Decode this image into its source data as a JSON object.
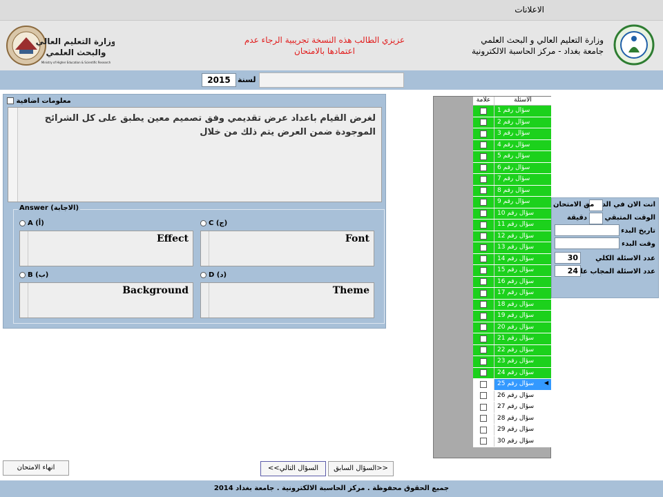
{
  "window": {
    "title": "الاعلانات"
  },
  "banner": {
    "notice_line1": "عزيزي الطالب هذه النسخة تجريبية الرجاء عدم",
    "notice_line2": "اعتمادها بالامتحان",
    "org_line1": "وزارة التعليم العالي و البحث العلمي",
    "org_line2": "جامعة بغداد - مركز الحاسبة الالكترونية",
    "ministry_logo_text1": "وزارة التعليم العالي",
    "ministry_logo_text2": "والبحث العلمي",
    "ministry_logo_en": "Ministry of Higher Education & Scientific Research"
  },
  "toolbar": {
    "year_label": "لسنة",
    "year_value": "2015"
  },
  "question": {
    "additional_info_label": "معلومات اضافية",
    "text": "لغرض القيام باعداد عرض تقديمي وفق تصميم معين يطبق على  كل الشرائح الموجودة ضمن العرض يتم ذلك من خلال",
    "answer_legend": "Answer (الاجابة)",
    "options": {
      "A": {
        "label": "A (أ)",
        "value": "Effect"
      },
      "B": {
        "label": "B (ب)",
        "value": "Background"
      },
      "C": {
        "label": "C (ج)",
        "value": "Font"
      },
      "D": {
        "label": "D (د)",
        "value": "Theme"
      }
    }
  },
  "question_list": {
    "header_mark": "علامة",
    "header_questions": "الاسئلة",
    "answered_color": "#1cd11c",
    "selected_color": "#3399ff",
    "items": [
      "سؤال رقم 1",
      "سؤال رقم 2",
      "سؤال رقم 3",
      "سؤال رقم 4",
      "سؤال رقم 5",
      "سؤال رقم 6",
      "سؤال رقم 7",
      "سؤال رقم 8",
      "سؤال رقم 9",
      "سؤال رقم 10",
      "سؤال رقم 11",
      "سؤال رقم 12",
      "سؤال رقم 13",
      "سؤال رقم 14",
      "سؤال رقم 15",
      "سؤال رقم 16",
      "سؤال رقم 17",
      "سؤال رقم 18",
      "سؤال رقم 19",
      "سؤال رقم 20",
      "سؤال رقم 21",
      "سؤال رقم 22",
      "سؤال رقم 23",
      "سؤال رقم 24",
      "سؤال رقم 25",
      "سؤال رقم 26",
      "سؤال رقم 27",
      "سؤال رقم 28",
      "سؤال رقم 29",
      "سؤال رقم 30"
    ],
    "answered_count": 24,
    "selected_number": 25
  },
  "info": {
    "now_label": "انت الان في الدقيقة",
    "now_suffix": "من الامتحان",
    "remaining_label": "الوقت المتبقي",
    "remaining_suffix": "دقيقة",
    "start_date_label": "تاريخ البدء",
    "start_time_label": "وقت البدء",
    "total_label": "عدد الاسئلة الكلي",
    "total_value": "30",
    "answered_label": "عدد الاسئلة المجاب عليها",
    "answered_value": "24"
  },
  "buttons": {
    "end_exam": "انهاء الامتحان",
    "next": "السؤال التالي>>",
    "previous": "<<السؤال السابق"
  },
  "footer": {
    "text": "جميع الحقوق محفوظة . مركز الحاسبة الالكترونية . جامعة بغداد 2014"
  }
}
